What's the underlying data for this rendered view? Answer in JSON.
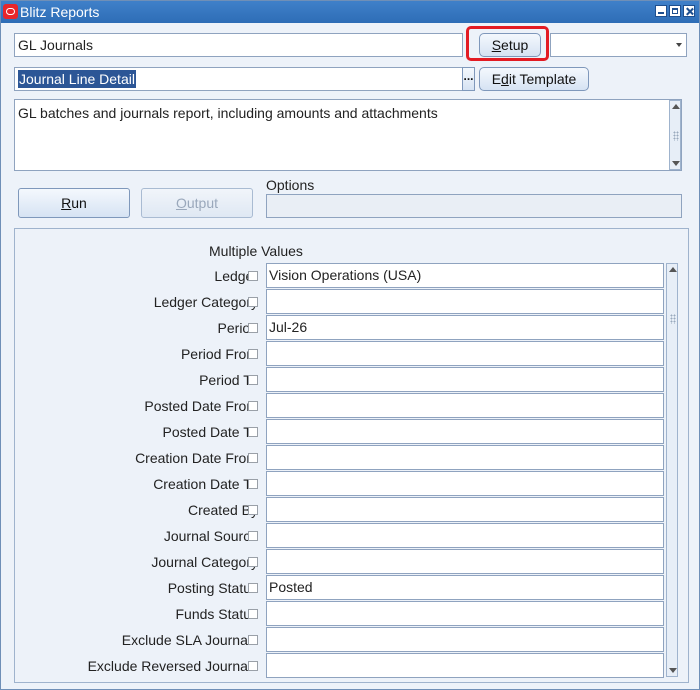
{
  "window": {
    "title": "Blitz Reports"
  },
  "report": {
    "name": "GL Journals",
    "template": "Journal Line Detail",
    "description": "GL batches and journals report, including amounts and attachments",
    "template_lov_glyph": "..."
  },
  "buttons": {
    "setup": {
      "mnemonic": "S",
      "rest": "etup"
    },
    "edit_template": {
      "pre": "E",
      "mnemonic": "d",
      "rest": "it Template"
    },
    "run": {
      "mnemonic": "R",
      "rest": "un"
    },
    "output": {
      "mnemonic": "O",
      "rest": "utput"
    }
  },
  "options": {
    "label": "Options",
    "value": ""
  },
  "parameters": {
    "header": "Multiple Values",
    "items": [
      {
        "label": "Ledger",
        "value": "Vision Operations (USA)"
      },
      {
        "label": "Ledger Category",
        "value": ""
      },
      {
        "label": "Period",
        "value": "Jul-26"
      },
      {
        "label": "Period From",
        "value": ""
      },
      {
        "label": "Period To",
        "value": ""
      },
      {
        "label": "Posted Date From",
        "value": ""
      },
      {
        "label": "Posted Date To",
        "value": ""
      },
      {
        "label": "Creation Date From",
        "value": ""
      },
      {
        "label": "Creation Date To",
        "value": ""
      },
      {
        "label": "Created By",
        "value": ""
      },
      {
        "label": "Journal Source",
        "value": ""
      },
      {
        "label": "Journal Category",
        "value": ""
      },
      {
        "label": "Posting Status",
        "value": "Posted"
      },
      {
        "label": "Funds Status",
        "value": ""
      },
      {
        "label": "Exclude SLA Journals",
        "value": ""
      },
      {
        "label": "Exclude Reversed Journals",
        "value": ""
      }
    ]
  },
  "colors": {
    "titlebar": "#3f80c9",
    "highlight": "#e31b23",
    "window_bg": "#edf2f9",
    "selection": "#2c5696"
  }
}
